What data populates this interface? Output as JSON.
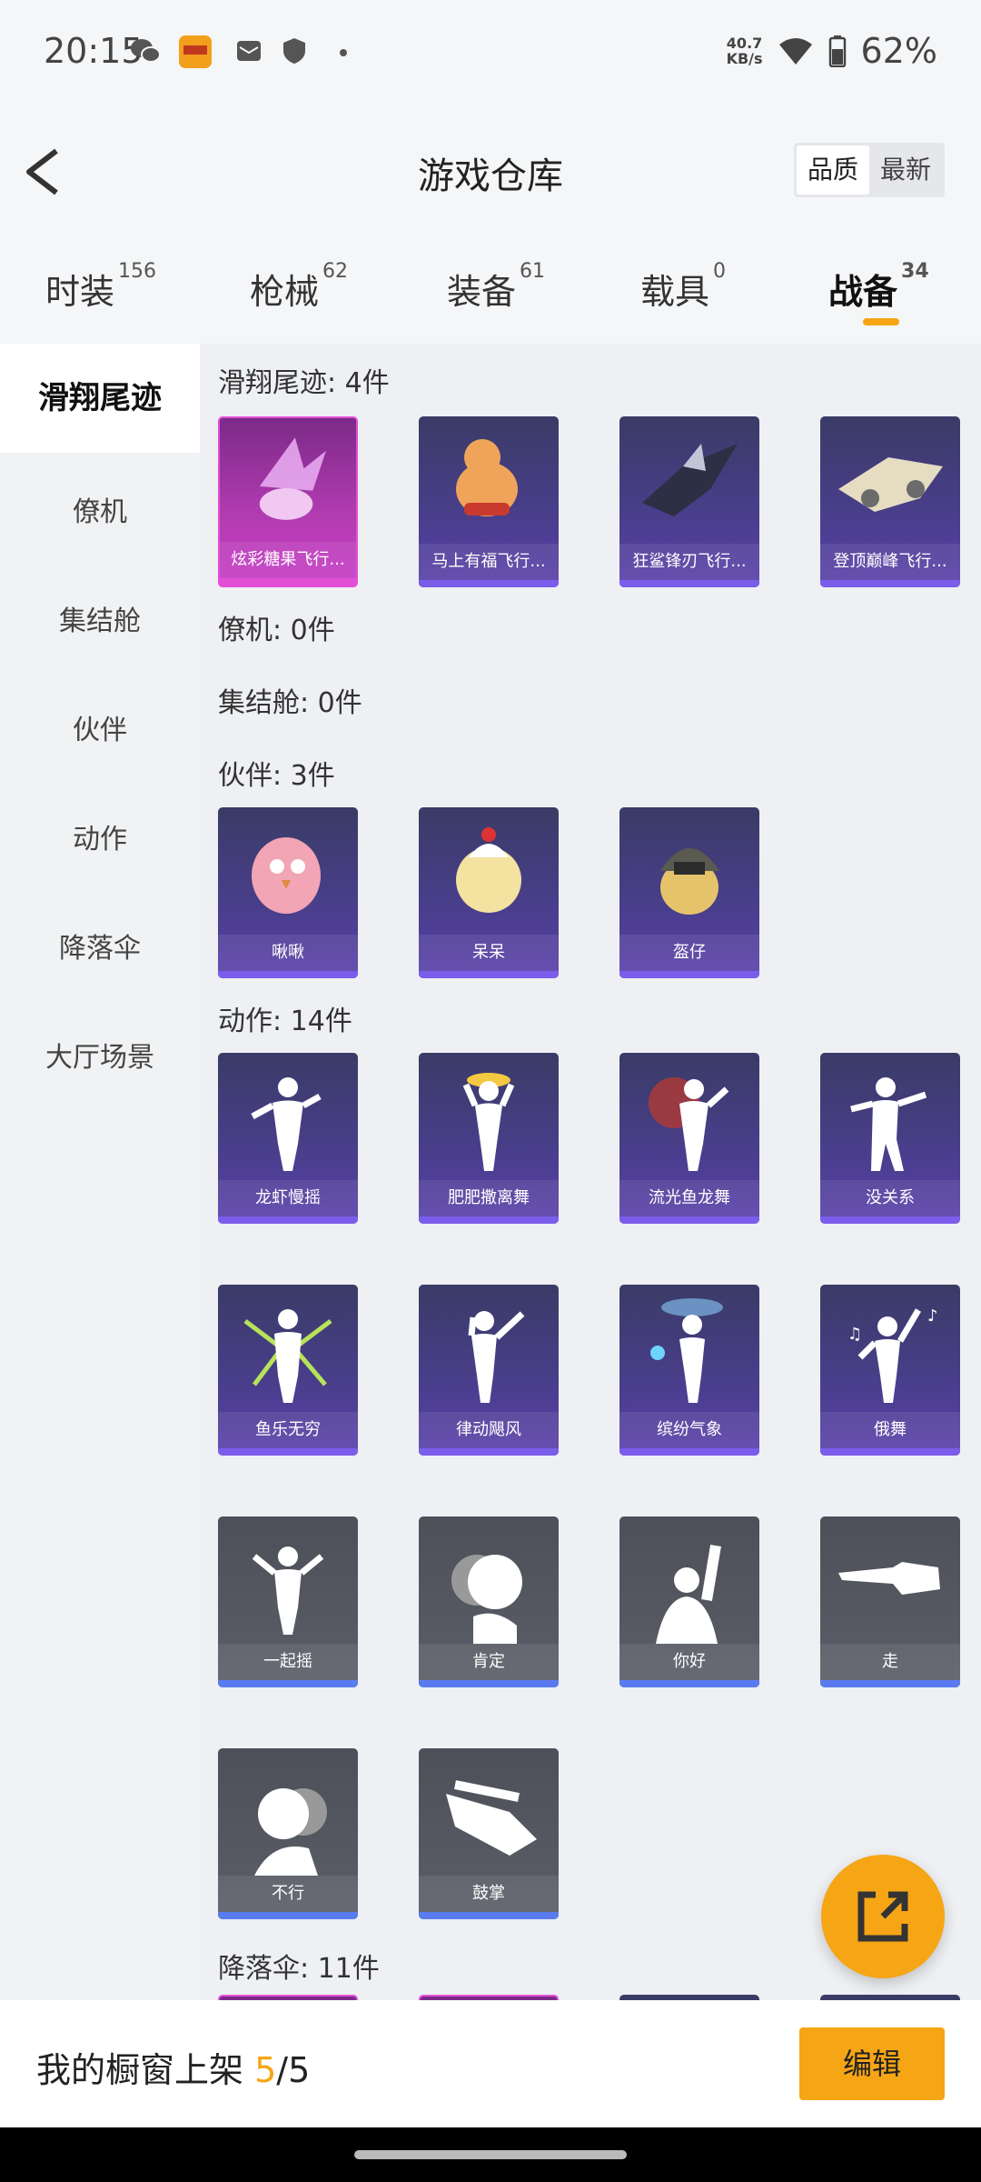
{
  "status_bar": {
    "time": "20:15",
    "speed_top": "40.7",
    "speed_bottom": "KB/s",
    "battery": "62%",
    "icons": [
      "wechat-icon",
      "game-app-icon",
      "mail-icon",
      "shield-icon",
      "dot-icon",
      "wifi-icon",
      "battery-icon"
    ]
  },
  "header": {
    "title": "游戏仓库",
    "sort_options": [
      "品质",
      "最新"
    ],
    "sort_active": "品质"
  },
  "tabs": [
    {
      "label": "时装",
      "count": "156"
    },
    {
      "label": "枪械",
      "count": "62"
    },
    {
      "label": "装备",
      "count": "61"
    },
    {
      "label": "载具",
      "count": "0"
    },
    {
      "label": "战备",
      "count": "34"
    }
  ],
  "active_tab": "战备",
  "sidebar": {
    "items": [
      "滑翔尾迹",
      "僚机",
      "集结舱",
      "伙伴",
      "动作",
      "降落伞",
      "大厅场景"
    ],
    "active": "滑翔尾迹"
  },
  "sections": {
    "trail": {
      "title": "滑翔尾迹: 4件",
      "items": [
        "炫彩糖果飞行...",
        "马上有福飞行...",
        "狂鲨锋刃飞行...",
        "登顶巅峰飞行..."
      ]
    },
    "wingman": {
      "title": "僚机: 0件"
    },
    "pod": {
      "title": "集结舱: 0件"
    },
    "partner": {
      "title": "伙伴: 3件",
      "items": [
        "啾啾",
        "呆呆",
        "盔仔"
      ]
    },
    "emote": {
      "title": "动作: 14件",
      "items": [
        "龙虾慢摇",
        "肥肥撒离舞",
        "流光鱼龙舞",
        "没关系",
        "鱼乐无穷",
        "律动飓风",
        "缤纷气象",
        "俄舞",
        "一起摇",
        "肯定",
        "你好",
        "走",
        "不行",
        "鼓掌"
      ]
    },
    "parachute": {
      "title": "降落伞: 11件"
    }
  },
  "footer": {
    "label": "我的橱窗上架",
    "current": "5",
    "total": "/5",
    "edit": "编辑"
  },
  "colors": {
    "accent": "#f6a515",
    "epic": "#5a40ab",
    "legendary": "#c63bc6",
    "common": "#5b5e68"
  }
}
